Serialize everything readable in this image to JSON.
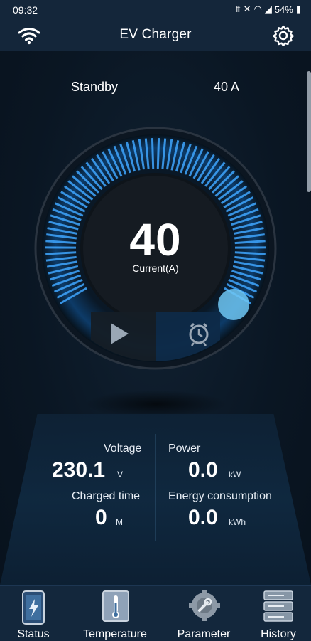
{
  "status_bar": {
    "time": "09:32",
    "icons": [
      "signal-icon",
      "mute-icon",
      "wifi-icon",
      "cell-signal-icon"
    ],
    "battery": "54%"
  },
  "app_bar": {
    "title": "EV Charger",
    "left_icon": "wifi-icon",
    "right_icon": "gear-icon"
  },
  "charger": {
    "state": "Standby",
    "max_current": "40 A",
    "dial_value": "40",
    "dial_label": "Current(A)",
    "play_icon": "play-icon",
    "timer_icon": "alarm-clock-icon"
  },
  "metrics": {
    "voltage": {
      "label": "Voltage",
      "value": "230.1",
      "unit": "V"
    },
    "power": {
      "label": "Power",
      "value": "0.0",
      "unit": "kW"
    },
    "charged_time": {
      "label": "Charged time",
      "value": "0",
      "unit": "M"
    },
    "energy": {
      "label": "Energy consumption",
      "value": "0.0",
      "unit": "kWh"
    }
  },
  "nav": [
    {
      "label": "Status",
      "icon": "phone-charging-icon"
    },
    {
      "label": "Temperature",
      "icon": "thermometer-icon"
    },
    {
      "label": "Parameter",
      "icon": "gear-wrench-icon"
    },
    {
      "label": "History",
      "icon": "server-list-icon"
    }
  ],
  "colors": {
    "background": "#0b1a2a",
    "bar": "#14263a",
    "accent": "#3fa6ff"
  }
}
